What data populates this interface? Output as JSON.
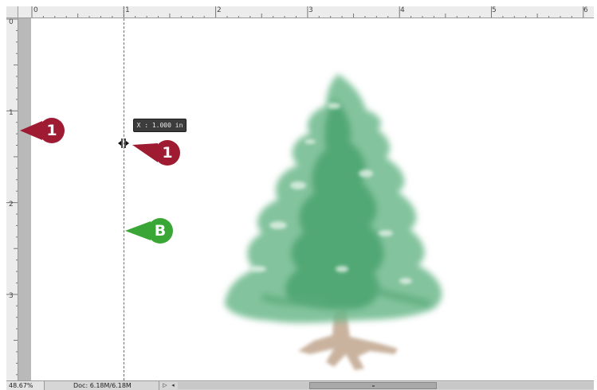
{
  "rulers": {
    "horizontal_labels": [
      "0",
      "1",
      "2",
      "3",
      "4",
      "5",
      "6"
    ],
    "vertical_labels": [
      "0",
      "1",
      "2",
      "3"
    ],
    "units": "in"
  },
  "guide_tooltip": "X : 1.000 in",
  "callouts": [
    {
      "label": "1",
      "color": "#9e1b32"
    },
    {
      "label": "1",
      "color": "#9e1b32"
    },
    {
      "label": "B",
      "color": "#3aa635"
    }
  ],
  "status_bar": {
    "zoom": "48.67%",
    "doc_info": "Doc: 6.18M/6.18M"
  },
  "colors": {
    "canvas": "#ffffff",
    "pasteboard": "#b9b9b9",
    "ruler": "#ececec",
    "tree_foliage": "#5fae7f",
    "tree_trunk": "#b9a08a"
  },
  "icons": [
    "move-guide-cursor-icon",
    "play-arrow-icon",
    "scroll-left-arrow-icon",
    "scroll-right-arrow-icon"
  ]
}
